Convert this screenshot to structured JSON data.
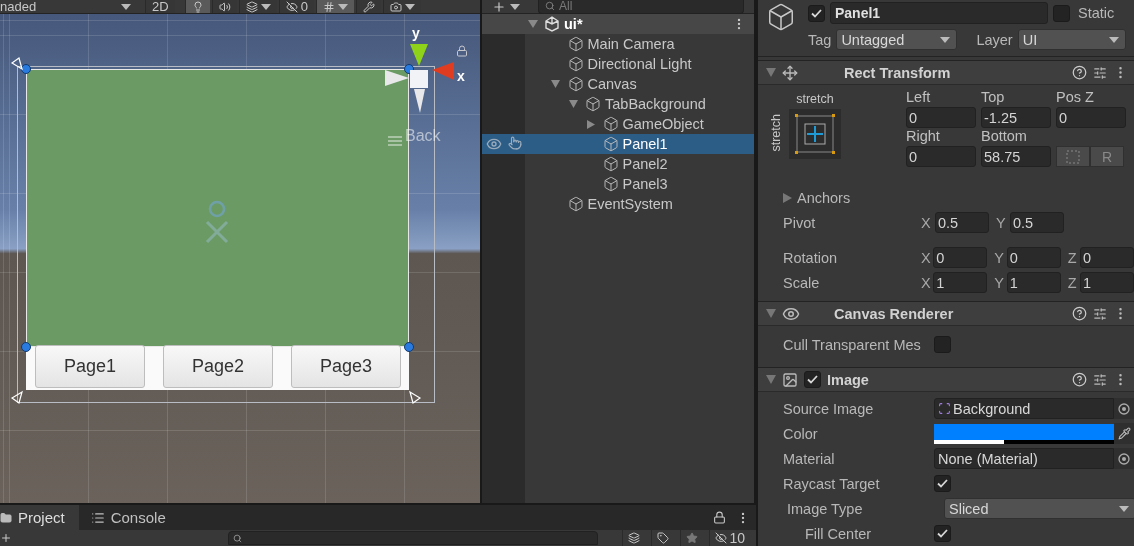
{
  "scene_view": {
    "toolbar": {
      "shading": "naded",
      "toggles": [
        {
          "kind": "mode",
          "label": "2D",
          "on": false
        },
        {
          "kind": "lighting",
          "on": true
        },
        {
          "kind": "audio",
          "on": false
        },
        {
          "kind": "effects",
          "on": false
        },
        {
          "kind": "hidden",
          "count": "0",
          "on": false
        },
        {
          "kind": "grid",
          "on": true
        },
        {
          "kind": "tools",
          "on": false
        },
        {
          "kind": "camera",
          "on": false
        }
      ]
    },
    "gizmo": {
      "y_label": "y",
      "x_label": "x"
    },
    "back_label": "Back",
    "page_buttons": [
      "Page1",
      "Page2",
      "Page3"
    ]
  },
  "hierarchy": {
    "search_placeholder": "All",
    "scene": {
      "name": "ui*",
      "expanded": true,
      "children": [
        {
          "name": "Main Camera",
          "has_children": false,
          "selected": false
        },
        {
          "name": "Directional Light",
          "has_children": false,
          "selected": false
        },
        {
          "name": "Canvas",
          "has_children": true,
          "expanded": true,
          "selected": false,
          "children": [
            {
              "name": "TabBackground",
              "has_children": true,
              "expanded": true,
              "selected": false,
              "children": [
                {
                  "name": "GameObject",
                  "has_children": true,
                  "expanded": false,
                  "selected": false
                },
                {
                  "name": "Panel1",
                  "has_children": false,
                  "selected": true
                },
                {
                  "name": "Panel2",
                  "has_children": false,
                  "selected": false
                },
                {
                  "name": "Panel3",
                  "has_children": false,
                  "selected": false
                }
              ]
            }
          ]
        },
        {
          "name": "EventSystem",
          "has_children": false,
          "selected": false
        }
      ]
    }
  },
  "inspector": {
    "object": {
      "active": true,
      "name": "Panel1",
      "static": false,
      "static_label": "Static",
      "tag_label": "Tag",
      "tag": "Untagged",
      "layer_label": "Layer",
      "layer": "UI"
    },
    "components": [
      {
        "kind": "rect_transform",
        "title": "Rect Transform",
        "expanded": true,
        "preset_top": "stretch",
        "preset_side": "stretch",
        "offsets": [
          {
            "label": "Left",
            "value": "0"
          },
          {
            "label": "Top",
            "value": "-1.25"
          },
          {
            "label": "Pos Z",
            "value": "0"
          },
          {
            "label": "Right",
            "value": "0"
          },
          {
            "label": "Bottom",
            "value": "58.75"
          }
        ],
        "raw_button": "R",
        "anchors": {
          "label": "Anchors",
          "expanded": false
        },
        "vectors": [
          {
            "label": "Pivot",
            "axes": [
              {
                "axis": "X",
                "value": "0.5"
              },
              {
                "axis": "Y",
                "value": "0.5"
              }
            ]
          },
          {
            "label": "Rotation",
            "axes": [
              {
                "axis": "X",
                "value": "0"
              },
              {
                "axis": "Y",
                "value": "0"
              },
              {
                "axis": "Z",
                "value": "0"
              }
            ]
          },
          {
            "label": "Scale",
            "axes": [
              {
                "axis": "X",
                "value": "1"
              },
              {
                "axis": "Y",
                "value": "1"
              },
              {
                "axis": "Z",
                "value": "1"
              }
            ]
          }
        ]
      },
      {
        "kind": "canvas_renderer",
        "title": "Canvas Renderer",
        "expanded": true,
        "properties": [
          {
            "kind": "checkbox",
            "label": "Cull Transparent Mes",
            "checked": false
          }
        ]
      },
      {
        "kind": "image",
        "title": "Image",
        "expanded": true,
        "enabled": true,
        "properties": [
          {
            "kind": "object",
            "label": "Source Image",
            "value": "Background"
          },
          {
            "kind": "color",
            "label": "Color",
            "color": "#007fff",
            "level": 0.39
          },
          {
            "kind": "object",
            "label": "Material",
            "value": "None (Material)"
          },
          {
            "kind": "checkbox",
            "label": "Raycast Target",
            "checked": true
          },
          {
            "kind": "dropdown",
            "label": "Image Type",
            "value": "Sliced",
            "children": [
              {
                "kind": "checkbox",
                "label": "Fill Center",
                "checked": true
              }
            ]
          }
        ]
      }
    ]
  },
  "bottom_panel": {
    "tabs": [
      {
        "label": "Project",
        "selected": true
      },
      {
        "label": "Console",
        "selected": false
      }
    ],
    "hidden_count": "10"
  }
}
